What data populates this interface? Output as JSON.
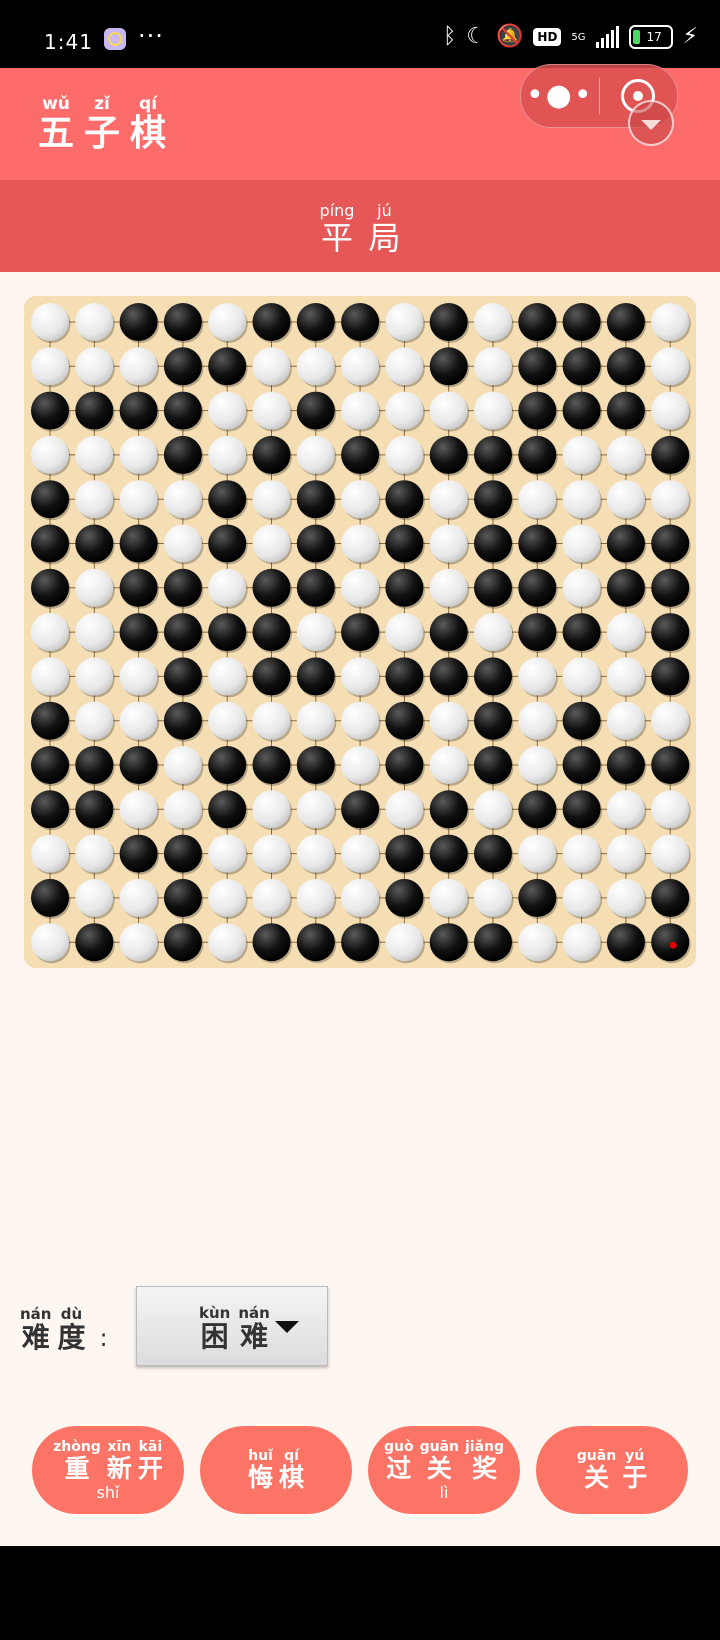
{
  "status_bar": {
    "time": "1:41",
    "more": "···",
    "battery": "17",
    "network": "5G"
  },
  "header": {
    "title": [
      {
        "py": "wǔ",
        "hz": "五"
      },
      {
        "py": "zǐ",
        "hz": "子"
      },
      {
        "py": "qí",
        "hz": "棋"
      }
    ],
    "capsule_more": "•●•"
  },
  "result": [
    {
      "py": "píng",
      "hz": "平"
    },
    {
      "py": "jú",
      "hz": "局"
    }
  ],
  "board": {
    "size": 15,
    "rows": [
      "WWBBWBBBWBWBBBW",
      "WWWBBWWWWBWBBBW",
      "BBBBWWBWWWWBBBW",
      "WWWBWBWBWBBBWWB",
      "BWWWBWBWBWBWWWW",
      "BBBWBWBWBWBBWBB",
      "BWBBWBBWBWBBWBB",
      "WWBBBBWBWBWBBWB",
      "WWWBWBBWBBBWWWB",
      "BWWBWWWWBWBWBWW",
      "BBBWBBBWBWBWBBB",
      "BBWWBWWBWBWBBWW",
      "WWBBWWWWBBBWWWW",
      "BWWBWWWWBWWBWWB",
      "WBWBWBBBWBBWWBB"
    ],
    "last_move": {
      "row": 14,
      "col": 14
    },
    "colors": {
      "board": "#f5deb3",
      "line": "#8a6a3a",
      "last_move_marker": "#e00000"
    }
  },
  "difficulty": {
    "label": [
      {
        "py": "nán",
        "hz": "难"
      },
      {
        "py": "dù",
        "hz": "度"
      }
    ],
    "colon": ":",
    "selected": [
      {
        "py": "kùn",
        "hz": "困"
      },
      {
        "py": "nán",
        "hz": "难"
      }
    ]
  },
  "actions": [
    {
      "chars": [
        {
          "py": "zhòng",
          "hz": "重"
        },
        {
          "py": "xīn",
          "hz": "新"
        },
        {
          "py": "kāi",
          "hz": "开"
        }
      ],
      "under": "shǐ"
    },
    {
      "chars": [
        {
          "py": "huǐ",
          "hz": "悔"
        },
        {
          "py": "qí",
          "hz": "棋"
        }
      ],
      "under": ""
    },
    {
      "chars": [
        {
          "py": "guò",
          "hz": "过"
        },
        {
          "py": "guān",
          "hz": "关"
        },
        {
          "py": "jiǎng",
          "hz": "奖"
        }
      ],
      "under": "lì"
    },
    {
      "chars": [
        {
          "py": "guān",
          "hz": "关"
        },
        {
          "py": "yú",
          "hz": "于"
        }
      ],
      "under": ""
    }
  ],
  "colors": {
    "header": "#fd6b6b",
    "result_bar": "#e65757",
    "button": "#fb7466",
    "background": "#fef6f0"
  }
}
